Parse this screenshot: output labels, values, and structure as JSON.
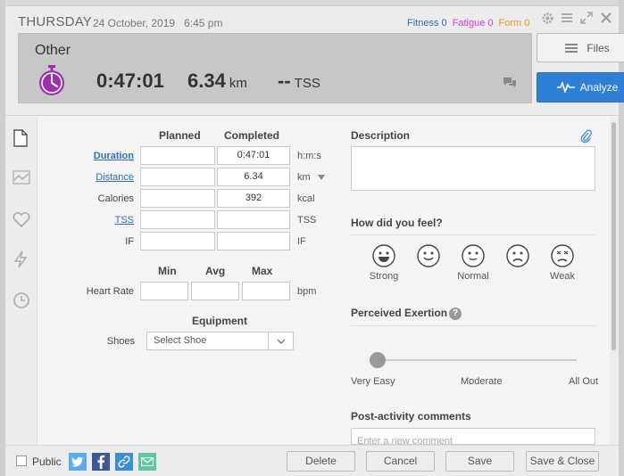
{
  "header": {
    "day": "THURSDAY",
    "date": "24 October, 2019",
    "time": "6:45 pm",
    "fitness_label": "Fitness",
    "fitness_value": "0",
    "fatigue_label": "Fatigue",
    "fatigue_value": "0",
    "form_label": "Form",
    "form_value": "0"
  },
  "summary": {
    "sport": "Other",
    "duration": "0:47:01",
    "distance": "6.34",
    "distance_unit": "km",
    "tss": "--",
    "tss_unit": "TSS"
  },
  "buttons": {
    "files": "Files",
    "analyze": "Analyze"
  },
  "table": {
    "col_planned": "Planned",
    "col_completed": "Completed",
    "rows": [
      {
        "label": "Duration",
        "planned": "",
        "completed": "0:47:01",
        "unit": "h:m:s"
      },
      {
        "label": "Distance",
        "planned": "",
        "completed": "6.34",
        "unit": "km"
      },
      {
        "label": "Calories",
        "planned": "",
        "completed": "392",
        "unit": "kcal"
      },
      {
        "label": "TSS",
        "planned": "",
        "completed": "",
        "unit": "TSS"
      },
      {
        "label": "IF",
        "planned": "",
        "completed": "",
        "unit": "IF"
      }
    ]
  },
  "heart_rate": {
    "col_min": "Min",
    "col_avg": "Avg",
    "col_max": "Max",
    "label": "Heart Rate",
    "unit": "bpm"
  },
  "equipment": {
    "heading": "Equipment",
    "shoes_label": "Shoes",
    "shoes_value": "Select Shoe"
  },
  "right": {
    "description_heading": "Description",
    "feel_heading": "How did you feel?",
    "feel_options": [
      "Strong",
      "",
      "Normal",
      "",
      "Weak"
    ],
    "exertion_heading": "Perceived Exertion",
    "exertion_help": "?",
    "exertion_level": 0,
    "exertion_labels": [
      "Very Easy",
      "Moderate",
      "All Out"
    ],
    "comments_heading": "Post-activity comments",
    "comment_placeholder": "Enter a new comment"
  },
  "footer": {
    "public_label": "Public",
    "delete": "Delete",
    "cancel": "Cancel",
    "save": "Save",
    "save_close": "Save & Close"
  },
  "colors": {
    "accent": "#2e7fd6",
    "stopwatch": "#9b2fae",
    "fitness": "#3366cc",
    "fatigue": "#d63ad0",
    "form": "#e89a1f",
    "twitter": "#55acee",
    "facebook": "#3b5998",
    "link": "#3a8fd8",
    "email": "#5cc8a0"
  }
}
